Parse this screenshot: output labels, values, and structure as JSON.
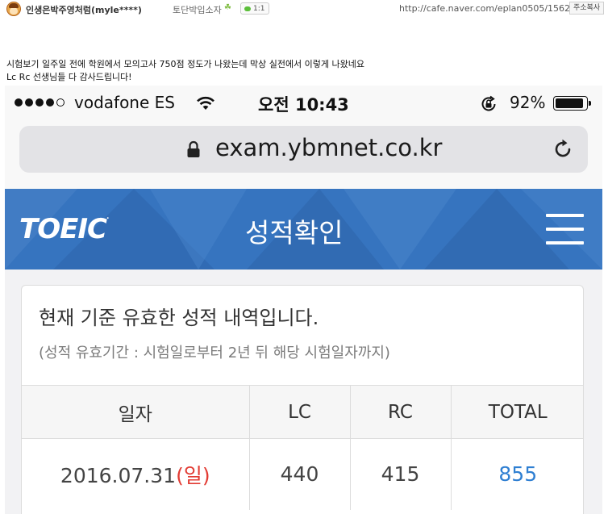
{
  "cafe_header": {
    "author": "인생은박주영처럼(myle****)",
    "level": "토단박입소자",
    "chat_count": "1:1",
    "post_url": "http://cafe.naver.com/eplan0505/1562",
    "copy_label": "주소복사"
  },
  "post": {
    "line1": "시험보기 일주일 전에 학원에서 모의고사 750점 정도가 나왔는데 막상 실전에서 이렇게 나왔네요",
    "line2": "Lc Rc 선생님들 다 감사드립니다!"
  },
  "status_bar": {
    "carrier": "vodafone ES",
    "time": "오전 10:43",
    "battery_percent": "92%",
    "battery_level": 0.92,
    "signal_bars_filled": 4,
    "signal_bars_total": 5
  },
  "browser": {
    "url": "exam.ybmnet.co.kr"
  },
  "site": {
    "logo": "TOEIC",
    "logo_mark": ".",
    "title": "성적확인",
    "header_color": "#3674bf"
  },
  "scores": {
    "heading": "현재 기준 유효한 성적 내역입니다.",
    "note": "(성적 유효기간 : 시험일로부터 2년 뒤 해당 시험일자까지)",
    "columns": [
      "일자",
      "LC",
      "RC",
      "TOTAL"
    ],
    "rows": [
      {
        "date": "2016.07.31",
        "weekday": "(일)",
        "lc": "440",
        "rc": "415",
        "total": "855"
      }
    ]
  },
  "colors": {
    "weekday_red": "#e23b33",
    "total_blue": "#2f7fd2"
  }
}
